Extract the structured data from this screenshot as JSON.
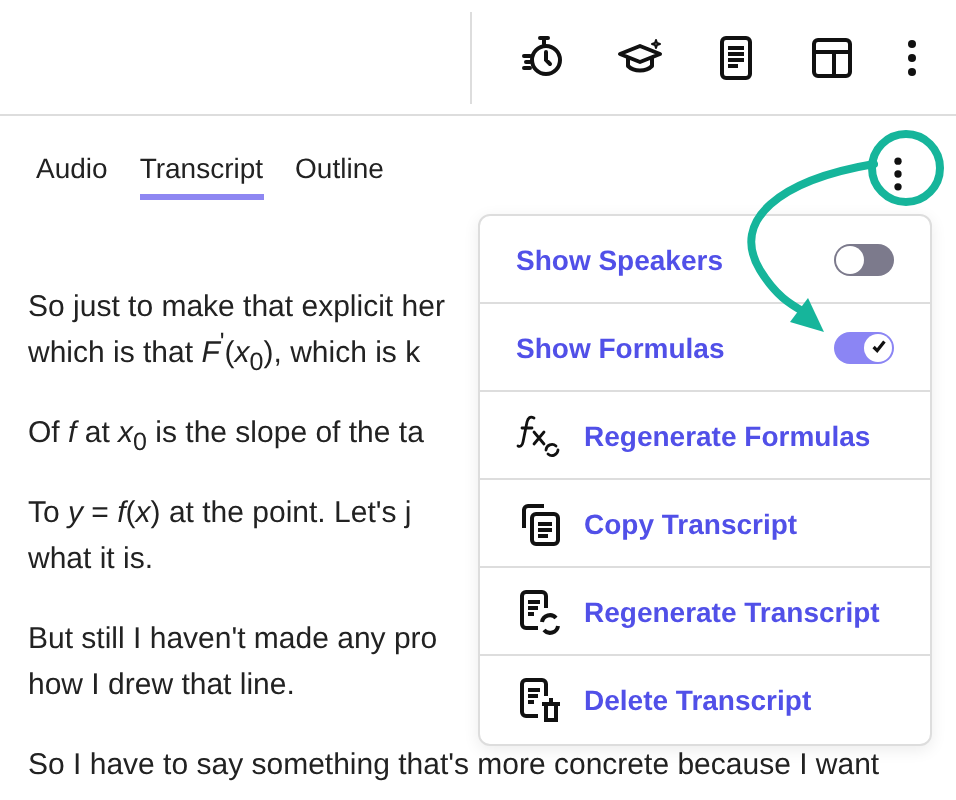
{
  "tabs": [
    {
      "label": "Audio",
      "selected": false
    },
    {
      "label": "Transcript",
      "selected": true
    },
    {
      "label": "Outline",
      "selected": false
    }
  ],
  "transcript": [
    {
      "lines": [
        "So just to make that explicit her",
        "which is that *F*$^{'}$(*x*$_{0}$), which is k"
      ]
    },
    {
      "lines": [
        "Of *f* at *x*$_{0}$ is the slope of the ta"
      ]
    },
    {
      "lines": [
        "To *y* = *f*(*x*) at the point. Let's j",
        "what it is."
      ]
    },
    {
      "lines": [
        "But still I haven't made any pro",
        "how I drew that line."
      ]
    },
    {
      "lines": [
        "So I have to say something that's more concrete because I want"
      ]
    }
  ],
  "menu": [
    {
      "kind": "toggle",
      "label": "Show Speakers",
      "on": false
    },
    {
      "kind": "toggle",
      "label": "Show Formulas",
      "on": true
    },
    {
      "kind": "formula",
      "label": "Regenerate Formulas"
    },
    {
      "kind": "copy",
      "label": "Copy Transcript"
    },
    {
      "kind": "regenerate",
      "label": "Regenerate Transcript"
    },
    {
      "kind": "delete",
      "label": "Delete Transcript"
    }
  ]
}
